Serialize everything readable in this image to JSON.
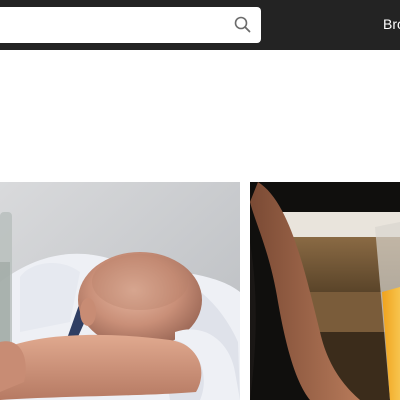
{
  "header": {
    "search": {
      "value": "",
      "icon": "search-icon"
    },
    "nav_link_label": "Bro"
  },
  "gallery": {
    "items": [
      {
        "alt": ""
      },
      {
        "alt": ""
      }
    ]
  },
  "colors": {
    "header_bg": "#232323",
    "page_bg": "#ffffff"
  }
}
